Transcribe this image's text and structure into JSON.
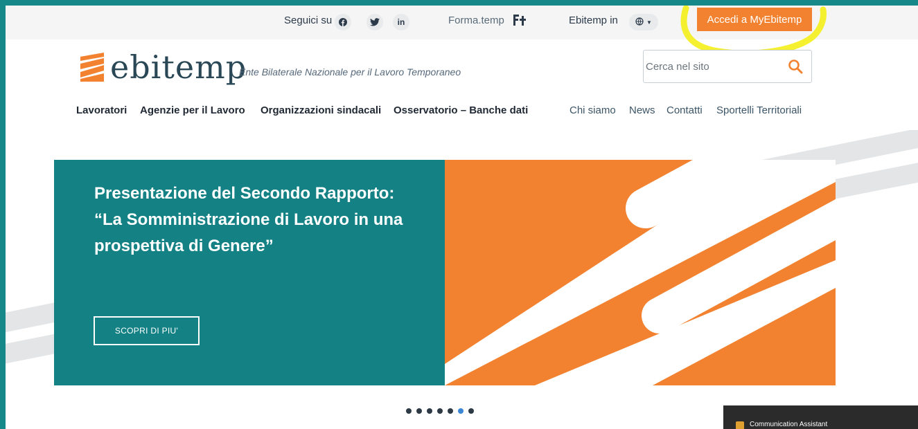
{
  "topbar": {
    "follow_label": "Seguici su",
    "social": [
      {
        "icon": "facebook-icon",
        "glyph": "f"
      },
      {
        "icon": "twitter-icon",
        "glyph": "🐦"
      },
      {
        "icon": "linkedin-icon",
        "glyph": "in"
      }
    ],
    "forma_label": "Forma.temp",
    "ebitemp_in_label": "Ebitemp in",
    "accedi_label": "Accedi a MyEbitemp",
    "accent_color": "#f2822f"
  },
  "header": {
    "logo_text": "ebitemp",
    "tagline": "Ente Bilaterale Nazionale per il Lavoro Temporaneo",
    "search": {
      "placeholder": "Cerca nel sito",
      "icon": "search-icon"
    }
  },
  "nav": {
    "primary": [
      "Lavoratori",
      "Agenzie per il Lavoro",
      "Organizzazioni sindacali",
      "Osservatorio – Banche dati"
    ],
    "secondary": [
      "Chi siamo",
      "News",
      "Contatti",
      "Sportelli Territoriali"
    ]
  },
  "hero": {
    "title": "Presentazione del Secondo Rapporto: “La Somministrazione di Lavoro in una prospettiva di Genere”",
    "button_label": "SCOPRI DI PIU'",
    "teal_color": "#148185",
    "orange_color": "#f2822f"
  },
  "carousel": {
    "count": 7,
    "active_index": 5
  },
  "overlay": {
    "comm_assistant_label": "Communication Assistant"
  }
}
